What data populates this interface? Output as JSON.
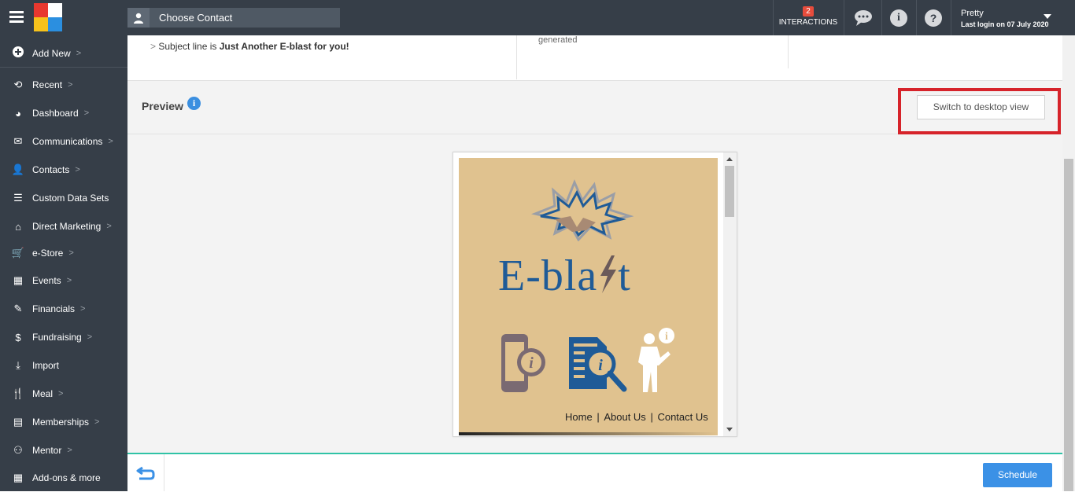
{
  "topbar": {
    "contact_placeholder": "Choose Contact",
    "interactions_count": "2",
    "interactions_label": "INTERACTIONS",
    "user_name": "Pretty",
    "last_login": "Last login on 07 July 2020"
  },
  "sidebar": {
    "add_new": "Add New",
    "items": [
      {
        "label": "Recent",
        "icon": "history-icon",
        "glyph": "⟲",
        "chevron": true
      },
      {
        "label": "Dashboard",
        "icon": "dashboard-icon",
        "glyph": "◕",
        "chevron": true
      },
      {
        "label": "Communications",
        "icon": "envelope-icon",
        "glyph": "✉",
        "chevron": true
      },
      {
        "label": "Contacts",
        "icon": "user-icon",
        "glyph": "👤",
        "chevron": true
      },
      {
        "label": "Custom Data Sets",
        "icon": "database-icon",
        "glyph": "☰",
        "chevron": false
      },
      {
        "label": "Direct Marketing",
        "icon": "warehouse-icon",
        "glyph": "⌂",
        "chevron": true
      },
      {
        "label": "e-Store",
        "icon": "cart-icon",
        "glyph": "🛒",
        "chevron": true
      },
      {
        "label": "Events",
        "icon": "calendar-icon",
        "glyph": "▦",
        "chevron": true
      },
      {
        "label": "Financials",
        "icon": "money-icon",
        "glyph": "✎",
        "chevron": true
      },
      {
        "label": "Fundraising",
        "icon": "moneybag-icon",
        "glyph": "$",
        "chevron": true
      },
      {
        "label": "Import",
        "icon": "download-icon",
        "glyph": "⤓",
        "chevron": false
      },
      {
        "label": "Meal",
        "icon": "cutlery-icon",
        "glyph": "🍴",
        "chevron": true
      },
      {
        "label": "Memberships",
        "icon": "id-card-icon",
        "glyph": "▤",
        "chevron": true
      },
      {
        "label": "Mentor",
        "icon": "people-icon",
        "glyph": "⚇",
        "chevron": true
      },
      {
        "label": "Add-ons & more",
        "icon": "grid-icon",
        "glyph": "▦",
        "chevron": false
      }
    ]
  },
  "info": {
    "subject_prefix": "Subject line is",
    "subject_value": "Just Another E-blast for you!",
    "generated": "generated"
  },
  "preview": {
    "title": "Preview",
    "switch_button": "Switch to desktop view"
  },
  "email": {
    "brand": "E-bla",
    "brand_end": "t",
    "links": [
      "Home",
      "About Us",
      "Contact Us"
    ],
    "separator": "|"
  },
  "footer": {
    "schedule": "Schedule"
  },
  "colors": {
    "topbar": "#363e48",
    "accent_blue": "#3b91e6",
    "highlight_red": "#d6232a",
    "teal_divider": "#2fc3a6",
    "email_bg": "#e0c28f"
  }
}
